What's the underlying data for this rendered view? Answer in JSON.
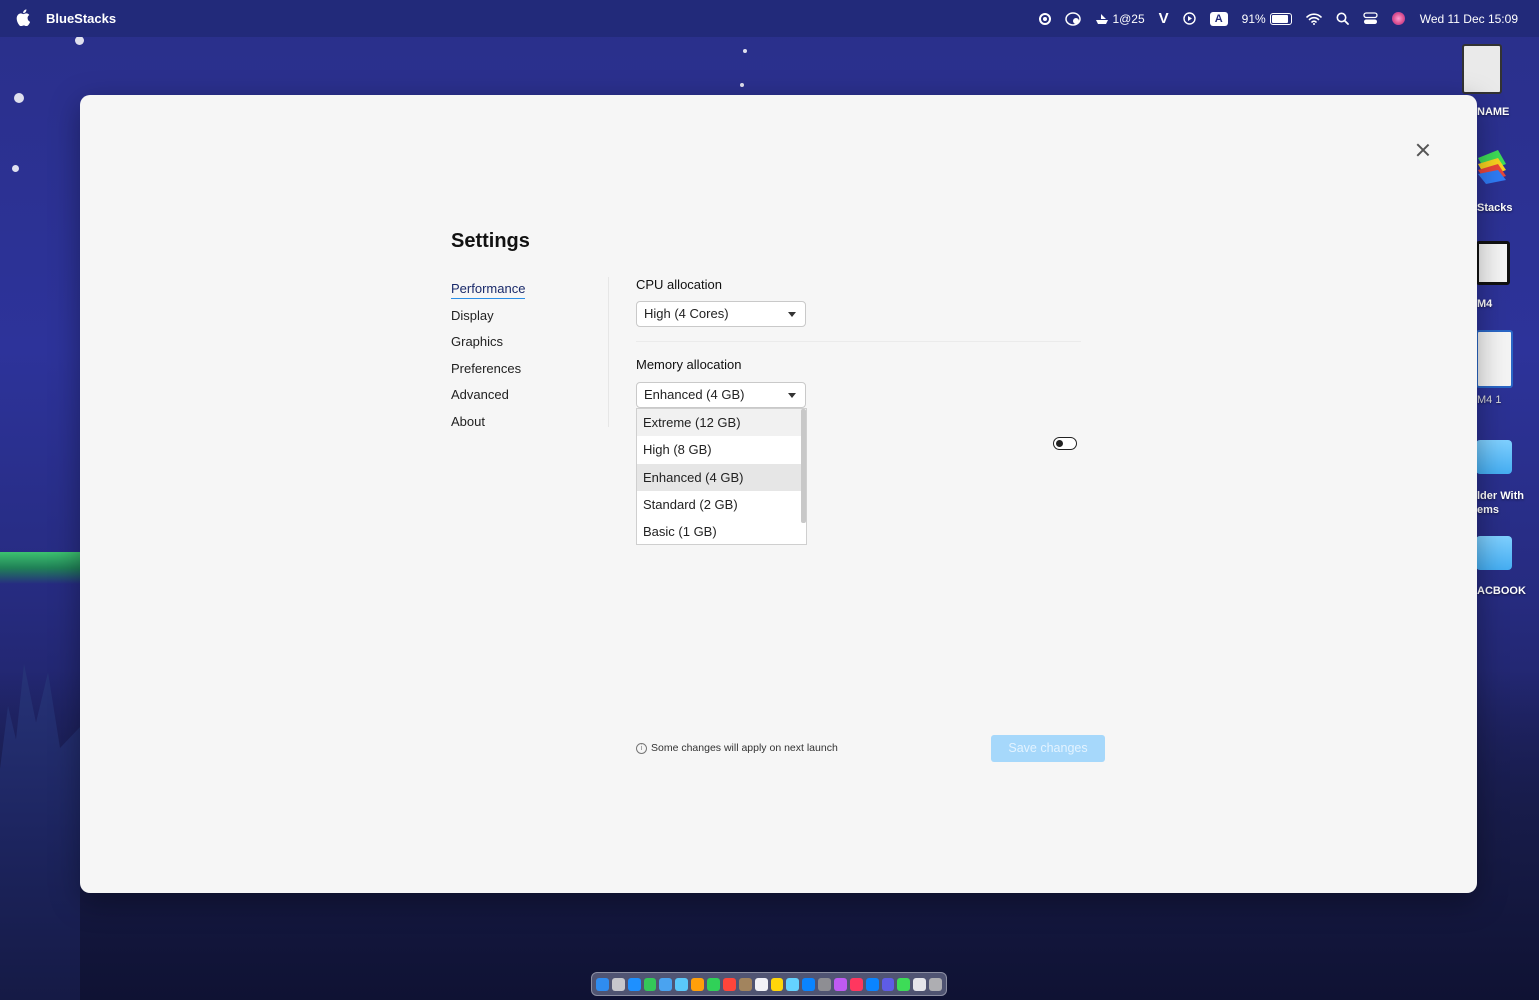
{
  "menubar": {
    "app_name": "BlueStacks",
    "timer": "1@25",
    "v_label": "V",
    "input_label": "A",
    "battery": "91%",
    "datetime": "Wed 11 Dec  15:09"
  },
  "desktop": {
    "icons": [
      {
        "label": "NAME"
      },
      {
        "label": "Stacks"
      },
      {
        "label": "M4"
      },
      {
        "label": "M4 1"
      },
      {
        "label": "lder With\nems"
      },
      {
        "label": "ACBOOK"
      }
    ]
  },
  "settings": {
    "title": "Settings",
    "nav": [
      "Performance",
      "Display",
      "Graphics",
      "Preferences",
      "Advanced",
      "About"
    ],
    "active_nav": "Performance",
    "cpu": {
      "label": "CPU allocation",
      "value": "High (4 Cores)"
    },
    "memory": {
      "label": "Memory allocation",
      "value": "Enhanced (4 GB)",
      "options": [
        "Extreme (12 GB)",
        "High (8 GB)",
        "Enhanced (4 GB)",
        "Standard (2 GB)",
        "Basic (1 GB)"
      ]
    },
    "note": "Some changes will apply on next launch",
    "save_label": "Save changes"
  },
  "colors": {
    "accent": "#2b8ee6",
    "save_disabled": "#a6d8fb",
    "menubar": "#222a7a"
  }
}
